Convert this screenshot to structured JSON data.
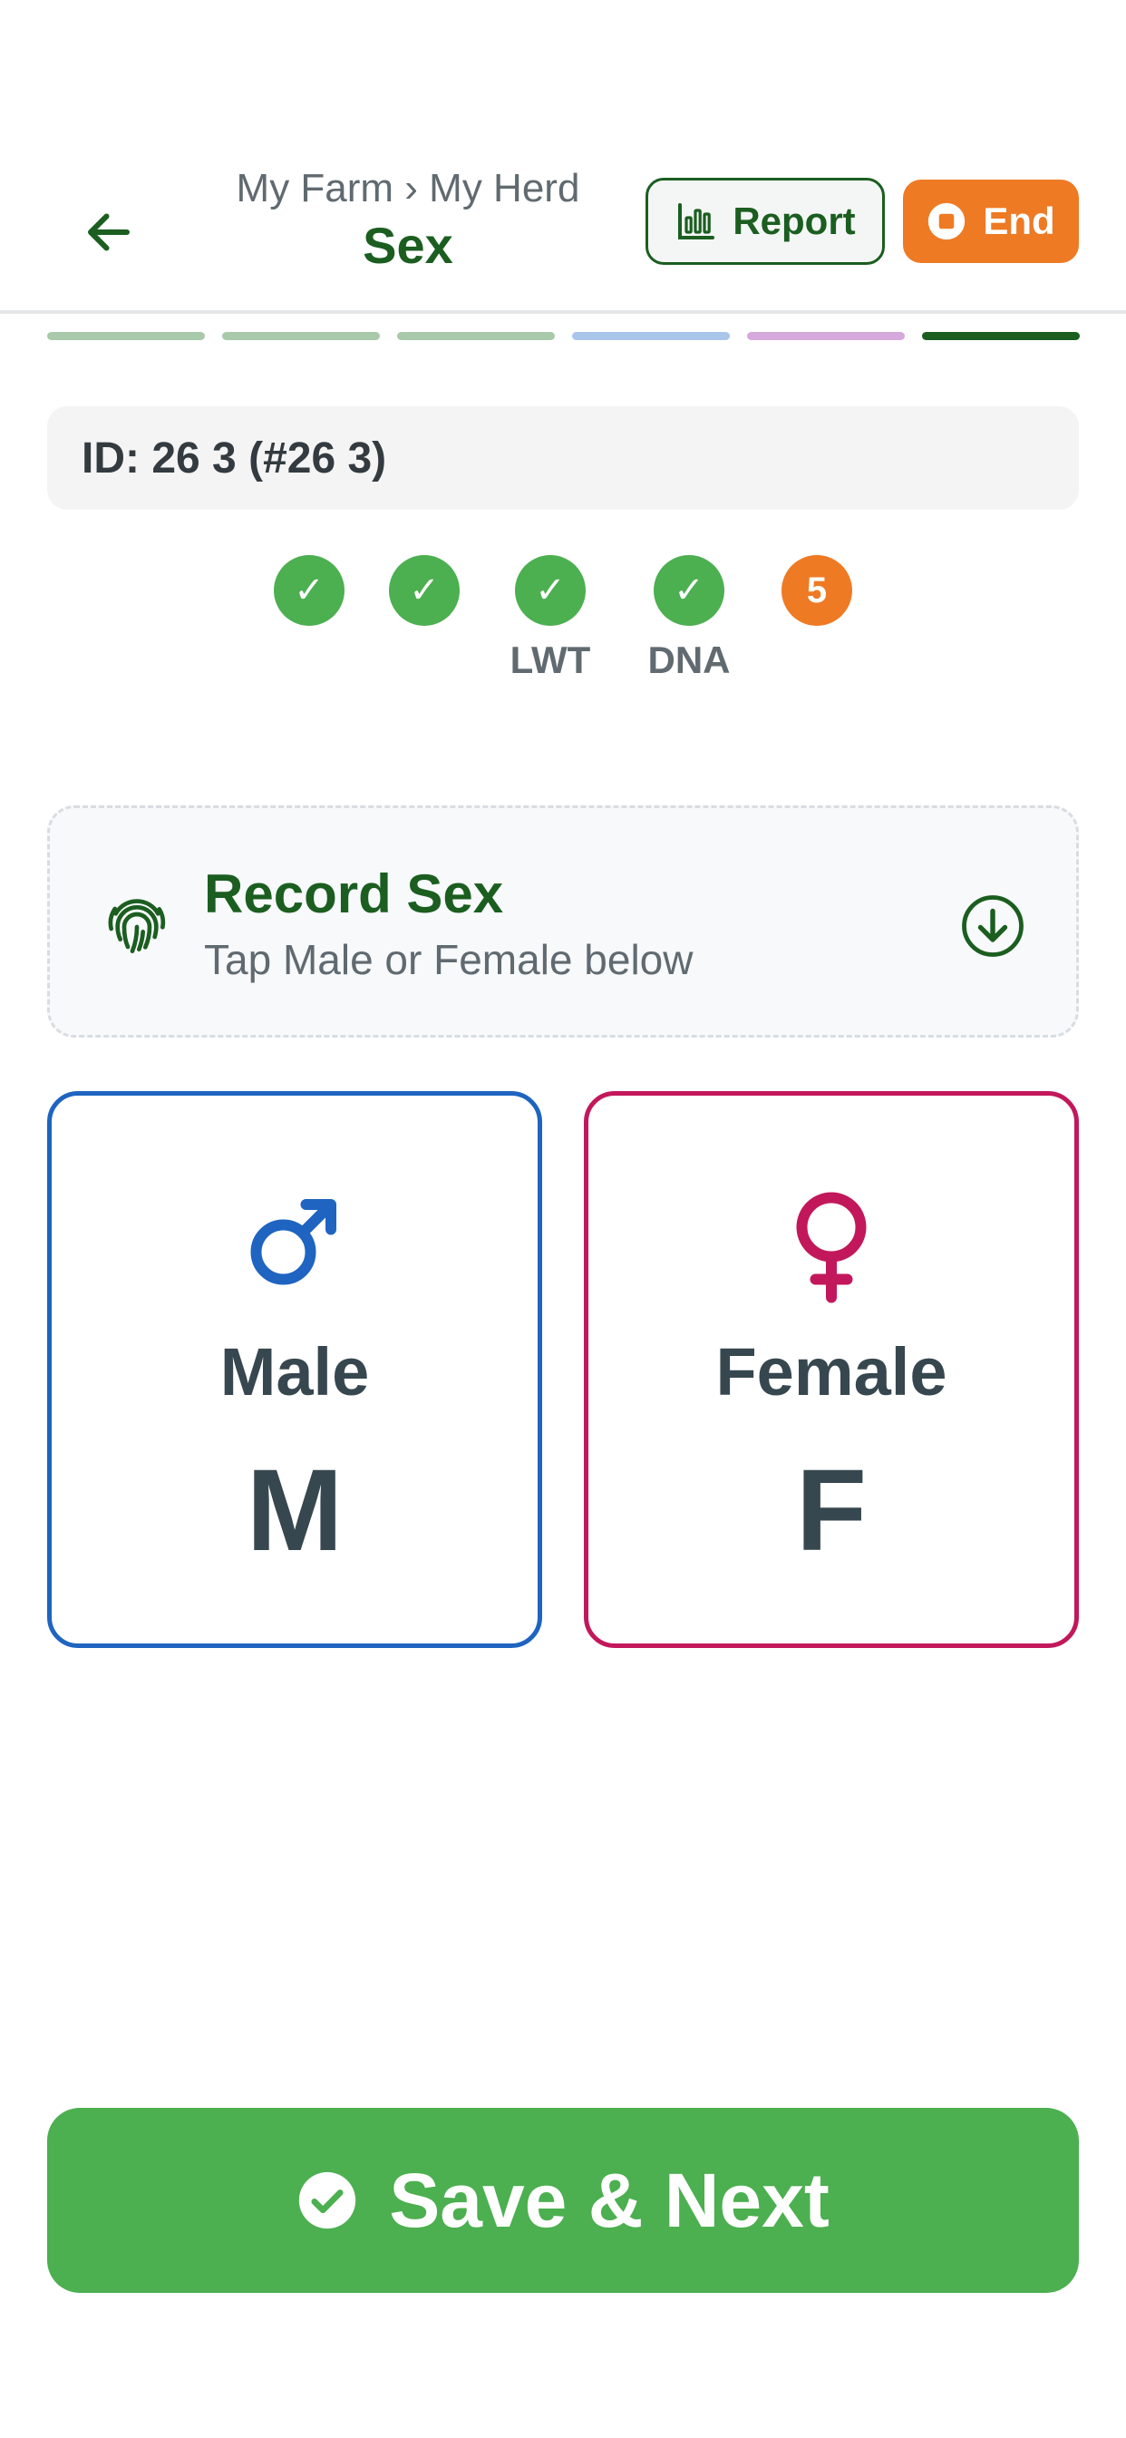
{
  "header": {
    "breadcrumb": "My Farm › My Herd",
    "title": "Sex",
    "report_label": "Report",
    "end_label": "End",
    "back_icon": "arrow-left-icon",
    "report_icon": "bar-chart-icon",
    "end_icon": "stop-circle-icon"
  },
  "colors": {
    "brand_green": "#1b5e20",
    "success_green": "#4caf50",
    "accent_orange": "#ee7a24",
    "male_blue": "#1e64c0",
    "female_pink": "#c2185b"
  },
  "progress": {
    "segments": [
      {
        "color": "#a8c9aa"
      },
      {
        "color": "#a8c9aa"
      },
      {
        "color": "#a8c9aa"
      },
      {
        "color": "#a9c6ea"
      },
      {
        "color": "#d6a9dc"
      },
      {
        "color": "#1b5e20"
      }
    ]
  },
  "animal": {
    "id_text": "ID: 26 3 (#26 3)"
  },
  "steps": [
    {
      "state": "done",
      "mark": "✓",
      "label": ""
    },
    {
      "state": "done",
      "mark": "✓",
      "label": ""
    },
    {
      "state": "done",
      "mark": "✓",
      "label": "LWT"
    },
    {
      "state": "done",
      "mark": "✓",
      "label": "DNA"
    },
    {
      "state": "current",
      "mark": "5",
      "label": ""
    }
  ],
  "record_card": {
    "title": "Record Sex",
    "subtitle": "Tap Male or Female below",
    "left_icon": "fingerprint-icon",
    "right_icon": "arrow-down-circle-icon"
  },
  "options": {
    "male": {
      "name": "Male",
      "key": "M",
      "icon": "male-symbol-icon"
    },
    "female": {
      "name": "Female",
      "key": "F",
      "icon": "female-symbol-icon"
    }
  },
  "save": {
    "label": "Save & Next",
    "icon": "check-circle-icon"
  }
}
